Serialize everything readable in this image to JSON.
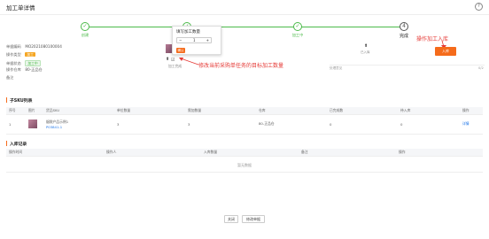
{
  "header": {
    "title": "加工单详情",
    "help_glyph": "?"
  },
  "steps": {
    "items": [
      {
        "label": "创建",
        "glyph": "✓"
      },
      {
        "label": "已确定",
        "glyph": "✓"
      },
      {
        "label": "加工中",
        "glyph": "✓"
      },
      {
        "label": "完成",
        "glyph": "4"
      }
    ]
  },
  "info": {
    "rows": [
      {
        "key": "单据编码",
        "value": "MO2021080100004"
      },
      {
        "key": "操作类型",
        "value": "加工"
      },
      {
        "key": "单据状态",
        "value": "加工中"
      },
      {
        "key": "操作仓库",
        "value": "80-正品仓"
      },
      {
        "key": "备注",
        "value": ""
      }
    ]
  },
  "product_preview": {
    "edit_label": "加工完成",
    "arrow_glyph": "⬆",
    "edit_glyph": "☑"
  },
  "popup": {
    "title": "填写加工数量",
    "minus": "−",
    "value": "1",
    "plus": "+",
    "confirm": "确认"
  },
  "annotations": {
    "edit_hint": "修改当前采购单任务的目标加工数量",
    "action_hint": "操作加工入库"
  },
  "right_panel": {
    "icon_glyph": "⬆",
    "icon_label": "已入库",
    "action_button": "入库",
    "remark_label": "处理意见",
    "remark_count": "0/2"
  },
  "product_section": {
    "title": "子SKU列表",
    "columns": [
      "序号",
      "图片",
      "货品SKU",
      "单位数量",
      "需加数量",
      "仓库",
      "已完成数",
      "待入库",
      "操作"
    ],
    "rows": [
      {
        "index": "1",
        "name": "烟袋产品示例1",
        "sku": "P03841-1",
        "unit_qty": "3",
        "need_qty": "3",
        "warehouse": "80-正品仓",
        "done": "0",
        "pending": "0",
        "action": "详情"
      }
    ]
  },
  "stock_section": {
    "title": "入库记录",
    "columns": [
      "操作时间",
      "操作人",
      "入库数量",
      "备注",
      "操作"
    ],
    "empty": "暂无数据"
  },
  "footer": {
    "close": "关闭",
    "edit": "修改单据"
  },
  "colors": {
    "accent": "#f56b1b",
    "success": "#4cba4a",
    "annotation": "#e53935"
  }
}
